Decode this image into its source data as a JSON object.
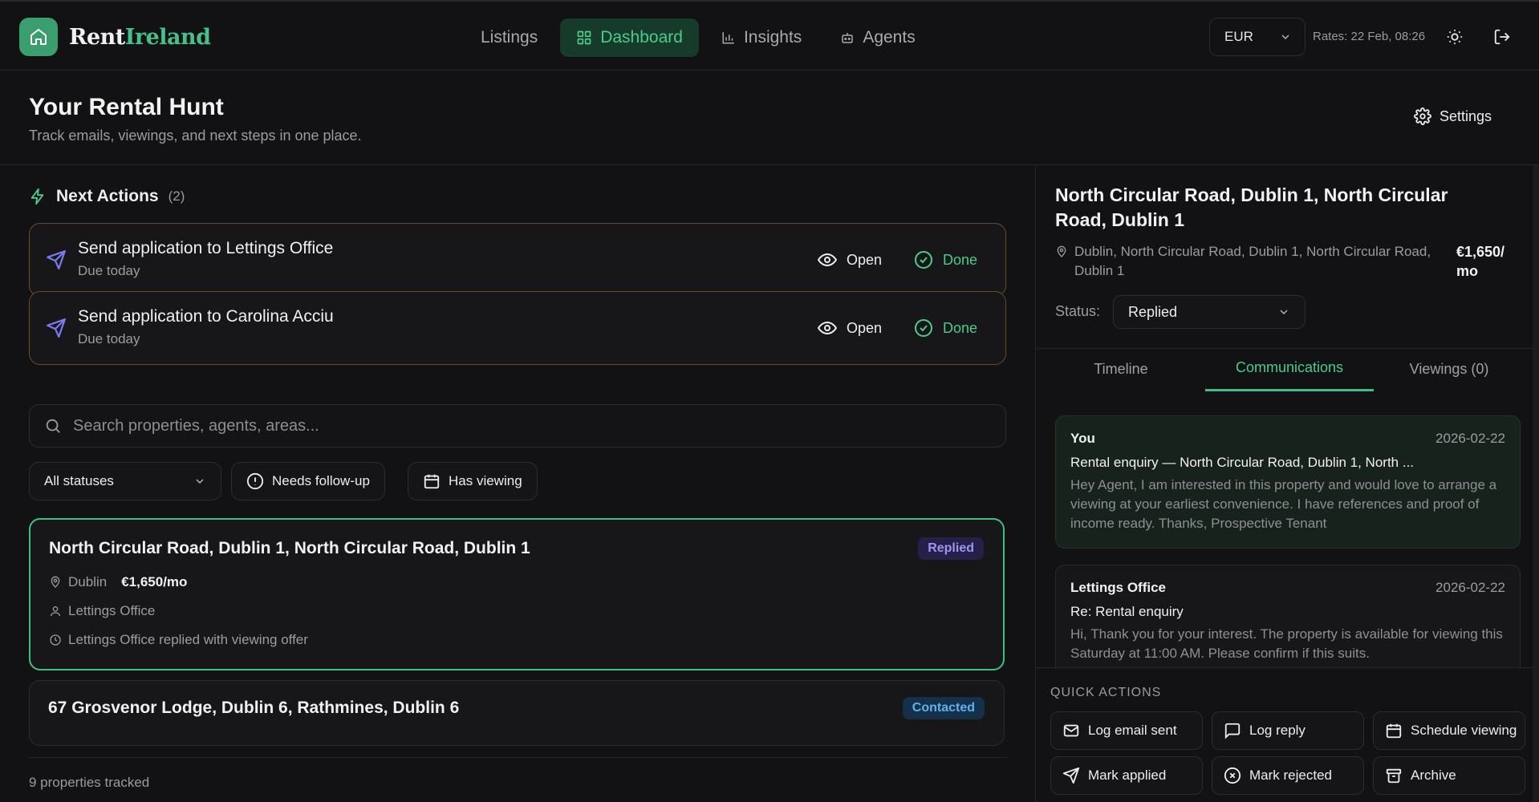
{
  "app": {
    "brand_part1": "Rent",
    "brand_part2": "Ireland",
    "accent_color": "#3fbf85"
  },
  "nav": {
    "listings": "Listings",
    "dashboard": "Dashboard",
    "insights": "Insights",
    "agents": "Agents",
    "active": "Dashboard"
  },
  "header": {
    "currency": "EUR",
    "rates": "Rates: 22 Feb, 08:26"
  },
  "page": {
    "title": "Your Rental Hunt",
    "subtitle": "Track emails, viewings, and next steps in one place.",
    "settings_label": "Settings"
  },
  "next_actions": {
    "title": "Next Actions",
    "count": "(2)",
    "open_label": "Open",
    "done_label": "Done",
    "items": [
      {
        "title": "Send application to Lettings Office",
        "due": "Due today"
      },
      {
        "title": "Send application to Carolina Acciu",
        "due": "Due today"
      }
    ]
  },
  "search": {
    "placeholder": "Search properties, agents, areas..."
  },
  "filters": {
    "status": "All statuses",
    "follow_up": "Needs follow-up",
    "has_viewing": "Has viewing"
  },
  "properties": [
    {
      "title": "North Circular Road, Dublin 1, North Circular Road, Dublin 1",
      "status": "Replied",
      "area": "Dublin",
      "price": "€1,650/mo",
      "agent": "Lettings Office",
      "last_update": "Lettings Office replied with viewing offer"
    },
    {
      "title": "67 Grosvenor Lodge, Dublin 6, Rathmines, Dublin 6",
      "status": "Contacted"
    }
  ],
  "footer": {
    "tracked": "9 properties tracked"
  },
  "detail": {
    "title": "North Circular Road, Dublin 1, North Circular Road, Dublin 1",
    "address": "Dublin, North Circular Road, Dublin 1, North Circular Road, Dublin 1",
    "price": "€1,650/ mo",
    "status_label": "Status:",
    "status_value": "Replied",
    "tabs": {
      "timeline": "Timeline",
      "communications": "Communications",
      "viewings": "Viewings (0)"
    },
    "messages": [
      {
        "from": "You",
        "date": "2026-02-22",
        "subject": "Rental enquiry — North Circular Road, Dublin 1, North ...",
        "body": "Hey Agent, I am interested in this property and would love to arrange a viewing at your earliest convenience. I have references and proof of income ready. Thanks, Prospective Tenant"
      },
      {
        "from": "Lettings Office",
        "date": "2026-02-22",
        "subject": "Re: Rental enquiry",
        "body": "Hi, Thank you for your interest. The property is available for viewing this Saturday at 11:00 AM. Please confirm if this suits."
      }
    ],
    "quick_actions": {
      "label": "QUICK ACTIONS",
      "log_email": "Log email sent",
      "log_reply": "Log reply",
      "schedule_viewing": "Schedule viewing",
      "mark_applied": "Mark applied",
      "mark_rejected": "Mark rejected",
      "archive": "Archive"
    }
  }
}
